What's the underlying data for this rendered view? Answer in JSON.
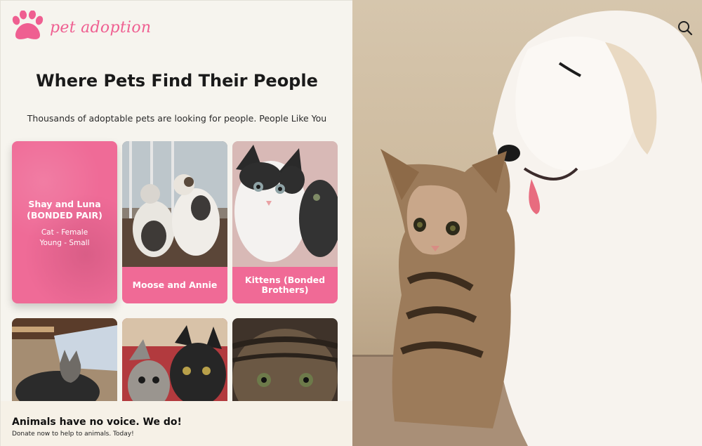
{
  "brand": {
    "name": "pet adoption",
    "accent": "#ef5f91"
  },
  "hero": {
    "title": "Where Pets Find Their People",
    "subtitle": "Thousands of adoptable pets are looking for people. People Like You"
  },
  "pets": {
    "featured": {
      "name_line1": "Shay and Luna",
      "name_line2": "(BONDED PAIR)",
      "meta_line1": "Cat - Female",
      "meta_line2": "Young - Small"
    },
    "cards": [
      {
        "name": "Moose and Annie"
      },
      {
        "name": "Kittens (Bonded Brothers)"
      }
    ]
  },
  "footer_banner": {
    "title": "Animals have no voice. We do!",
    "subtitle": "Donate now to help to animals. Today!"
  },
  "icons": {
    "search": "search-icon",
    "logo": "paw-icon"
  }
}
